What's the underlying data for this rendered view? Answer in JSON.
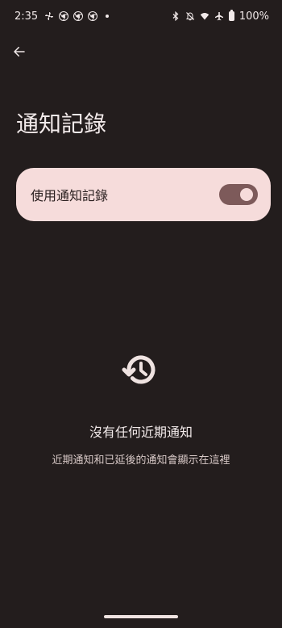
{
  "status_bar": {
    "time": "2:35",
    "battery": "100%",
    "left_icons": [
      "pinwheel-icon",
      "chrome-icon",
      "chrome-icon",
      "chrome-icon",
      "dot-icon"
    ],
    "right_icons": [
      "bluetooth-icon",
      "mute-icon",
      "wifi-icon",
      "airplane-icon",
      "battery-icon"
    ]
  },
  "header": {
    "back_icon": "arrow-left-icon",
    "title": "通知記錄"
  },
  "main_switch": {
    "label": "使用通知記錄",
    "state": "on"
  },
  "empty_state": {
    "icon": "history-icon",
    "title": "沒有任何近期通知",
    "subtitle": "近期通知和已延後的通知會顯示在這裡"
  },
  "theme": {
    "background": "#231d1d",
    "card": "#f6dcdb",
    "switch_track": "#7d5a5a",
    "text": "#f2eaea"
  }
}
